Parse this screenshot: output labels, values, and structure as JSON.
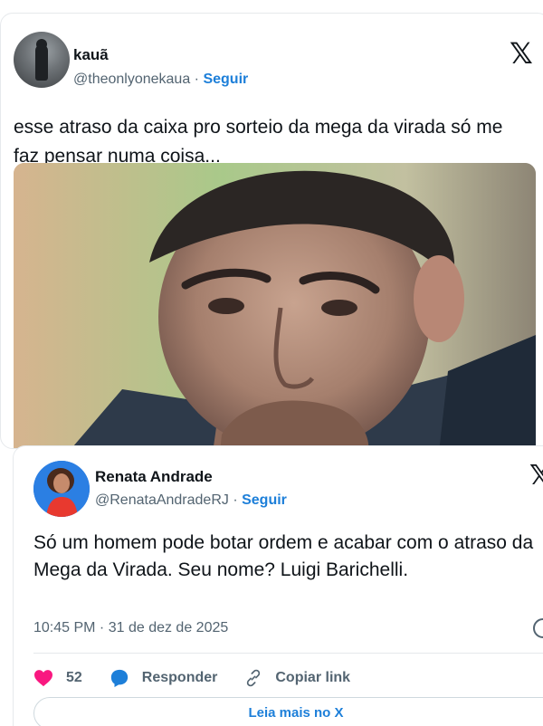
{
  "tweet1": {
    "name": "kauã",
    "handle": "@theonlyonekaua",
    "separator": " · ",
    "follow_label": "Seguir",
    "text": "esse atraso da caixa pro sorteio da mega da virada só me faz pensar numa coisa...",
    "logo_icon": "x-logo-icon"
  },
  "tweet2": {
    "name": "Renata Andrade",
    "handle": "@RenataAndradeRJ",
    "separator": " · ",
    "follow_label": "Seguir",
    "text": "Só um homem pode botar ordem e acabar com o atraso da Mega da Virada. Seu nome?  Luigi Barichelli.",
    "timestamp": "10:45 PM · 31 de dez de 2025",
    "likes": "52",
    "reply_label": "Responder",
    "copy_label": "Copiar link",
    "read_more_label": "Leia mais no X"
  },
  "colors": {
    "accent": "#1d7fd9",
    "like": "#f91880",
    "text": "#0f1419",
    "muted": "#536471"
  }
}
